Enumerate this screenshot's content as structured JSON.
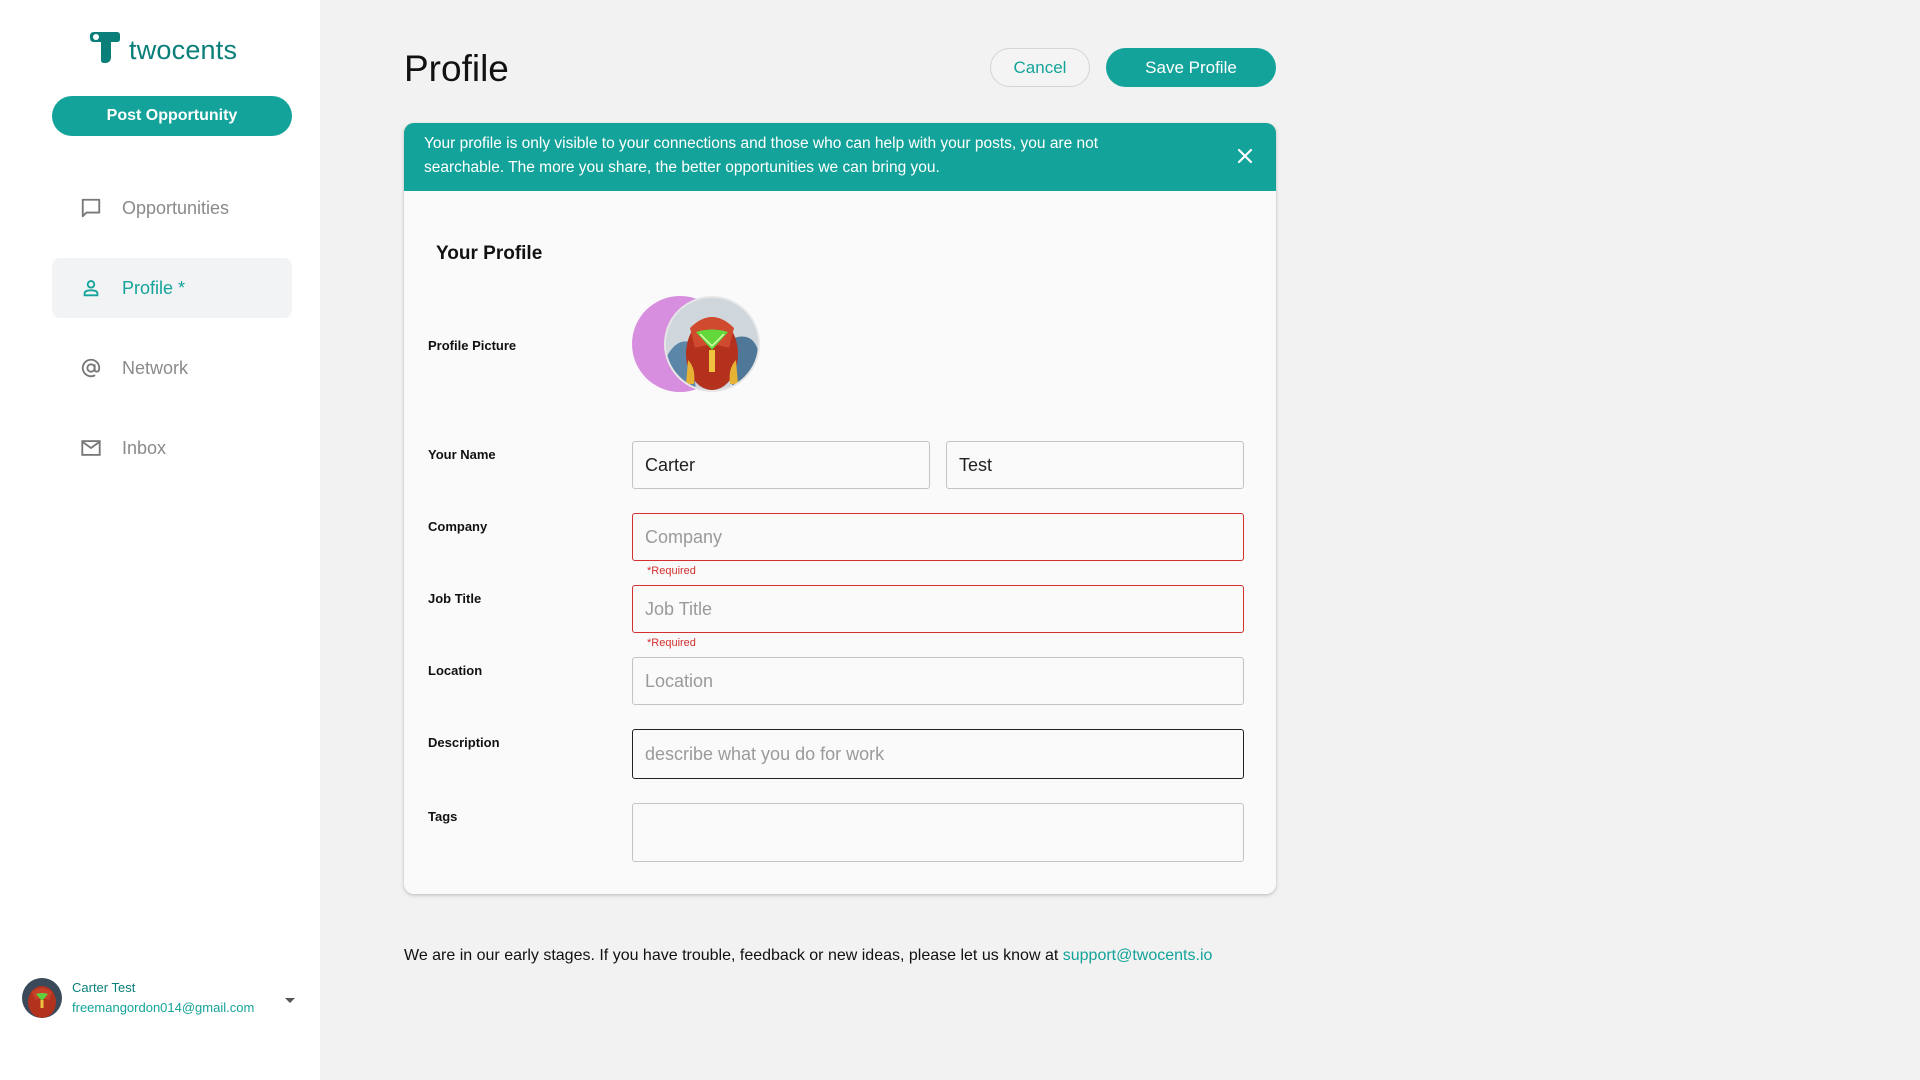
{
  "brand": {
    "name": "twocents",
    "color": "#0a7f7a",
    "accent": "#14a39a"
  },
  "sidebar": {
    "post_button": "Post Opportunity",
    "items": [
      {
        "label": "Opportunities",
        "icon": "chat-bubble-icon",
        "active": false
      },
      {
        "label": "Profile *",
        "icon": "person-icon",
        "active": true
      },
      {
        "label": "Network",
        "icon": "at-sign-icon",
        "active": false
      },
      {
        "label": "Inbox",
        "icon": "mail-icon",
        "active": false
      }
    ],
    "user": {
      "name": "Carter Test",
      "email": "freemangordon014@gmail.com"
    }
  },
  "header": {
    "title": "Profile",
    "cancel_label": "Cancel",
    "save_label": "Save Profile"
  },
  "banner": {
    "text": "Your profile is only visible to your connections and those who can help with your posts, you are not searchable. The more you share, the better opportunities we can bring you."
  },
  "form": {
    "section_title": "Your Profile",
    "picture_label": "Profile Picture",
    "name_label": "Your Name",
    "first_name": "Carter",
    "last_name": "Test",
    "company_label": "Company",
    "company_placeholder": "Company",
    "company_error": "*Required",
    "job_title_label": "Job Title",
    "job_title_placeholder": "Job Title",
    "job_title_error": "*Required",
    "location_label": "Location",
    "location_placeholder": "Location",
    "description_label": "Description",
    "description_placeholder": "describe what you do for work",
    "tags_label": "Tags"
  },
  "footer": {
    "text": "We are in our early stages. If you have trouble, feedback or new ideas, please let us know at ",
    "email": "support@twocents.io"
  }
}
